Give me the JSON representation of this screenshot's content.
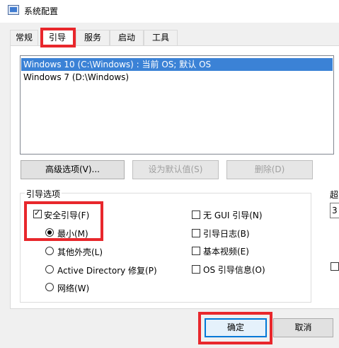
{
  "window": {
    "title": "系统配置",
    "icon": "msconfig-icon"
  },
  "tabs": [
    {
      "label": "常规",
      "active": false
    },
    {
      "label": "引导",
      "active": true
    },
    {
      "label": "服务",
      "active": false
    },
    {
      "label": "启动",
      "active": false
    },
    {
      "label": "工具",
      "active": false
    }
  ],
  "os_list": {
    "items": [
      {
        "label": "Windows 10 (C:\\Windows) : 当前 OS; 默认 OS",
        "selected": true
      },
      {
        "label": "Windows 7 (D:\\Windows)",
        "selected": false
      }
    ]
  },
  "buttons": {
    "advanced": "高级选项(V)...",
    "set_default": "设为默认值(S)",
    "delete": "删除(D)",
    "ok": "确定",
    "cancel": "取消"
  },
  "boot_options": {
    "title": "引导选项",
    "safe_boot": {
      "label": "安全引导(F)",
      "checked": true
    },
    "radios": [
      {
        "label": "最小(M)",
        "selected": true
      },
      {
        "label": "其他外壳(L)",
        "selected": false
      },
      {
        "label": "Active Directory 修复(P)",
        "selected": false
      },
      {
        "label": "网络(W)",
        "selected": false
      }
    ],
    "checks": [
      {
        "label": "无 GUI 引导(N)",
        "checked": false
      },
      {
        "label": "引导日志(B)",
        "checked": false
      },
      {
        "label": "基本视频(E)",
        "checked": false
      },
      {
        "label": "OS 引导信息(O)",
        "checked": false
      }
    ]
  },
  "timeout": {
    "label": "超",
    "value": "3"
  },
  "colors": {
    "highlight_red": "#e8272c",
    "selection_blue": "#3b82d6",
    "focus_blue": "#0078d7"
  }
}
